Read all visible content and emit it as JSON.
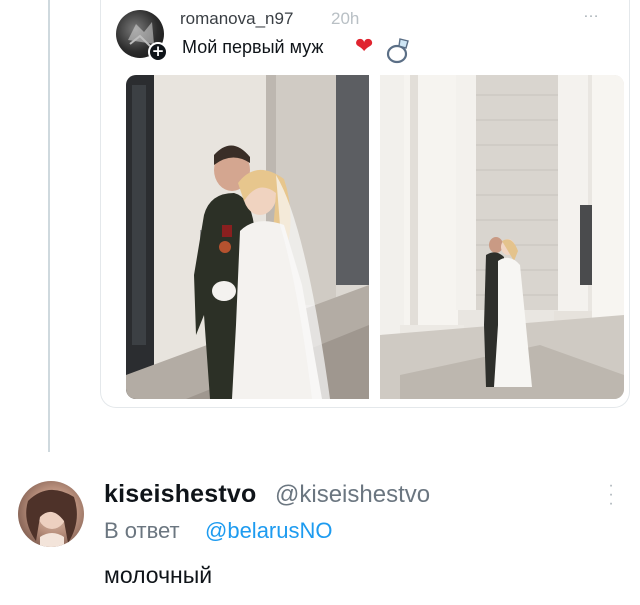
{
  "quoted_tweet": {
    "username": "romanova_n97",
    "time": "20h",
    "more_icon": "…",
    "text": "Мой первый муж",
    "heart_icon": "❤",
    "ring_icon": "ring-icon",
    "plus_icon": "+",
    "photos": [
      "couple-photo-embrace",
      "couple-photo-colonnade"
    ]
  },
  "reply": {
    "display_name": "kiseishestvo",
    "handle": "@kiseishestvo",
    "more_icon": "⋮",
    "replying_to_label": "В ответ",
    "replying_to_mention": "@belarusNO",
    "text": "молочный"
  },
  "colors": {
    "link": "#1d9bf0",
    "secondary_text": "#6b7680",
    "thread_line": "#cfd9de",
    "heart": "#e0242f"
  }
}
